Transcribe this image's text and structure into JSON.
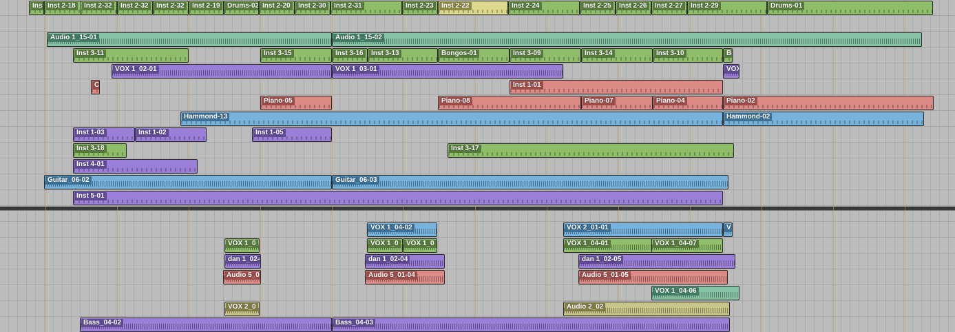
{
  "colors": {
    "green": "#8fbe6a",
    "greenLabel": "#557a3c",
    "teal": "#86c3a4",
    "tealLabel": "#3f7a62",
    "purple": "#9a7ed8",
    "purpleLabel": "#5e4a95",
    "blue": "#77b2dc",
    "blueLabel": "#3c6f96",
    "red": "#db8a86",
    "redLabel": "#9b4b48",
    "yellow": "#dcd98e",
    "yellowLabel": "#8c8944",
    "tan": "#c9c48a",
    "tanLabel": "#7f7b45",
    "grid": "#a6a6a6",
    "barline": "#c8a03c"
  },
  "regions": [
    {
      "label": "Ins",
      "color": "green",
      "kind": "midi"
    },
    {
      "label": "Inst 2-18",
      "color": "green",
      "kind": "midi"
    },
    {
      "label": "Inst 2-32",
      "color": "green",
      "kind": "midi"
    },
    {
      "label": "Inst 2-32",
      "color": "green",
      "kind": "midi"
    },
    {
      "label": "Inst 2-32",
      "color": "green",
      "kind": "midi"
    },
    {
      "label": "Inst 2-19",
      "color": "green",
      "kind": "midi"
    },
    {
      "label": "Drums-02",
      "color": "green",
      "kind": "midi"
    },
    {
      "label": "Inst 2-20",
      "color": "green",
      "kind": "midi"
    },
    {
      "label": "Inst 2-30",
      "color": "green",
      "kind": "midi"
    },
    {
      "label": "Inst 2-31",
      "color": "green",
      "kind": "midi"
    },
    {
      "label": "Inst 2-23",
      "color": "green",
      "kind": "midi"
    },
    {
      "label": "Inst 2-22",
      "color": "yellow",
      "kind": "midi"
    },
    {
      "label": "Inst 2-24",
      "color": "green",
      "kind": "midi"
    },
    {
      "label": "Inst 2-25",
      "color": "green",
      "kind": "midi"
    },
    {
      "label": "Inst 2-26",
      "color": "green",
      "kind": "midi"
    },
    {
      "label": "Inst 2-27",
      "color": "green",
      "kind": "midi"
    },
    {
      "label": "Inst 2-29",
      "color": "green",
      "kind": "midi"
    },
    {
      "label": "Drums-01",
      "color": "green",
      "kind": "midi"
    },
    {
      "label": "Audio 1_15-01",
      "color": "teal",
      "kind": "wave"
    },
    {
      "label": "Audio 1_15-02",
      "color": "teal",
      "kind": "wave"
    },
    {
      "label": "Inst 3-11",
      "color": "green",
      "kind": "midi"
    },
    {
      "label": "Inst 3-15",
      "color": "green",
      "kind": "midi"
    },
    {
      "label": "Inst 3-16",
      "color": "green",
      "kind": "midi"
    },
    {
      "label": "Inst 3-13",
      "color": "green",
      "kind": "midi"
    },
    {
      "label": "Bongos-01",
      "color": "green",
      "kind": "midi"
    },
    {
      "label": "Inst 3-09",
      "color": "green",
      "kind": "midi"
    },
    {
      "label": "Inst 3-14",
      "color": "green",
      "kind": "midi"
    },
    {
      "label": "Inst 3-10",
      "color": "green",
      "kind": "midi"
    },
    {
      "label": "Bo",
      "color": "green",
      "kind": "midi"
    },
    {
      "label": "VOX 1_02-01",
      "color": "purple",
      "kind": "wave"
    },
    {
      "label": "VOX 1_03-01",
      "color": "purple",
      "kind": "wave"
    },
    {
      "label": "VOX",
      "color": "purple",
      "kind": "wave"
    },
    {
      "label": "C",
      "color": "red",
      "kind": "midi"
    },
    {
      "label": "Inst 1-01",
      "color": "red",
      "kind": "midi"
    },
    {
      "label": "Piano-05",
      "color": "red",
      "kind": "midi"
    },
    {
      "label": "Piano-08",
      "color": "red",
      "kind": "midi"
    },
    {
      "label": "Piano-07",
      "color": "red",
      "kind": "midi"
    },
    {
      "label": "Piano-04",
      "color": "red",
      "kind": "midi"
    },
    {
      "label": "Piano-02",
      "color": "red",
      "kind": "midi"
    },
    {
      "label": "Hammond-13",
      "color": "blue",
      "kind": "midi"
    },
    {
      "label": "Hammond-02",
      "color": "blue",
      "kind": "midi"
    },
    {
      "label": "Inst 1-03",
      "color": "purple",
      "kind": "midi"
    },
    {
      "label": "Inst 1-02",
      "color": "purple",
      "kind": "midi"
    },
    {
      "label": "Inst 1-05",
      "color": "purple",
      "kind": "midi"
    },
    {
      "label": "Inst 3-18",
      "color": "green",
      "kind": "midi"
    },
    {
      "label": "Inst 3-17",
      "color": "green",
      "kind": "midi"
    },
    {
      "label": "Inst 4-01",
      "color": "purple",
      "kind": "midi"
    },
    {
      "label": "Guitar_06-02",
      "color": "blue",
      "kind": "wave"
    },
    {
      "label": "Guitar_06-03",
      "color": "blue",
      "kind": "wave"
    },
    {
      "label": "Inst 5-01",
      "color": "purple",
      "kind": "midi"
    },
    {
      "label": "VOX 1_04-02",
      "color": "blue",
      "kind": "wave"
    },
    {
      "label": "VOX 2_01-01",
      "color": "blue",
      "kind": "wave"
    },
    {
      "label": "V",
      "color": "blue",
      "kind": "wave"
    },
    {
      "label": "VOX 1_0",
      "color": "green",
      "kind": "wave"
    },
    {
      "label": "VOX 1_0",
      "color": "green",
      "kind": "wave"
    },
    {
      "label": "VOX 1_0",
      "color": "green",
      "kind": "wave"
    },
    {
      "label": "VOX 1_04-01",
      "color": "green",
      "kind": "wave"
    },
    {
      "label": "VOX 1_04-07",
      "color": "green",
      "kind": "wave"
    },
    {
      "label": "dan 1_02-0",
      "color": "purple",
      "kind": "wave"
    },
    {
      "label": "dan 1_02-04",
      "color": "purple",
      "kind": "wave"
    },
    {
      "label": "dan 1_02-05",
      "color": "purple",
      "kind": "wave"
    },
    {
      "label": "Audio 5_0",
      "color": "red",
      "kind": "wave"
    },
    {
      "label": "Audio 5_01-04",
      "color": "red",
      "kind": "wave"
    },
    {
      "label": "Audio 5_01-05",
      "color": "red",
      "kind": "wave"
    },
    {
      "label": "VOX 1_04-06",
      "color": "teal",
      "kind": "wave"
    },
    {
      "label": "VOX 2_0",
      "color": "tan",
      "kind": "wave"
    },
    {
      "label": "Audio 2_02",
      "color": "tan",
      "kind": "wave"
    },
    {
      "label": "Bass_04-02",
      "color": "purple",
      "kind": "wave"
    },
    {
      "label": "Bass_04-03",
      "color": "purple",
      "kind": "wave"
    }
  ]
}
